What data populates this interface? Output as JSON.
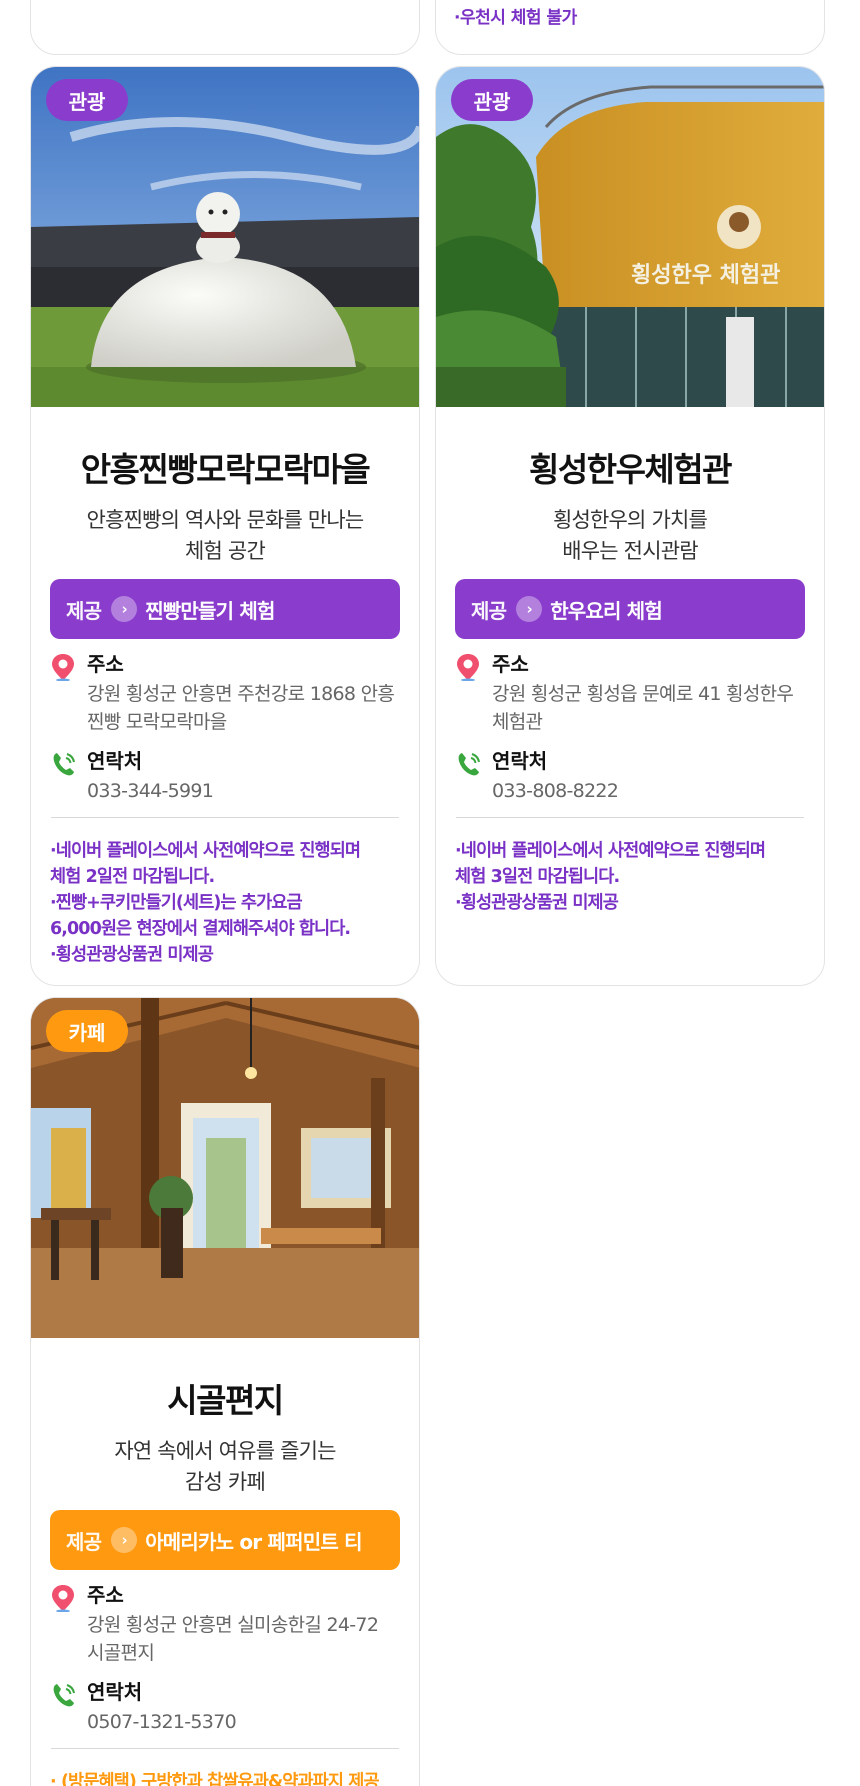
{
  "prev_cards": {
    "left_note": "",
    "right_note": "·우천시 체험 불가"
  },
  "cards": [
    {
      "category": "관광",
      "title": "안흥찐빵모락모락마을",
      "desc_line1": "안흥찐빵의 역사와 문화를 만나는",
      "desc_line2": "체험 공간",
      "offer_label": "제공",
      "offer_value": "찐빵만들기 체험",
      "address_label": "주소",
      "address_line1": "강원 횡성군 안흥면 주천강로 1868 안흥",
      "address_line2": "찐빵 모락모락마을",
      "contact_label": "연락처",
      "phone": "033-344-5991",
      "notes": [
        "·네이버 플레이스에서 사전예약으로 진행되며",
        " 체험 2일전 마감됩니다.",
        "·찐빵+쿠키만들기(세트)는 추가요금",
        " 6,000원은 현장에서 결제해주셔야 합니다.",
        "·횡성관광상품권 미제공"
      ],
      "accent": "#8a3ccc"
    },
    {
      "category": "관광",
      "title": "횡성한우체험관",
      "desc_line1": "횡성한우의 가치를",
      "desc_line2": "배우는 전시관람",
      "offer_label": "제공",
      "offer_value": "한우요리 체험",
      "address_label": "주소",
      "address_line1": "강원 횡성군 횡성읍 문예로 41 횡성한우",
      "address_line2": "체험관",
      "contact_label": "연락처",
      "phone": "033-808-8222",
      "notes": [
        "·네이버 플레이스에서 사전예약으로 진행되며",
        " 체험 3일전 마감됩니다.",
        "·횡성관광상품권 미제공"
      ],
      "building_sign": "횡성한우 체험관",
      "accent": "#8a3ccc"
    },
    {
      "category": "카페",
      "title": "시골편지",
      "desc_line1": "자연 속에서 여유를 즐기는",
      "desc_line2": "감성 카페",
      "offer_label": "제공",
      "offer_value": "아메리카노 or 페퍼민트 티",
      "address_label": "주소",
      "address_line1": "강원 횡성군 안흥면 실미송한길 24-72",
      "address_line2": "시골편지",
      "contact_label": "연락처",
      "phone": "0507-1321-5370",
      "notes": [
        "· (방문혜택) 구방한과 찹쌀유과&약과파지 제공"
      ],
      "accent": "#ff9a10"
    }
  ],
  "icons": {
    "address": "map-pin-icon",
    "contact": "phone-icon",
    "offer": "chevron-right-icon"
  }
}
